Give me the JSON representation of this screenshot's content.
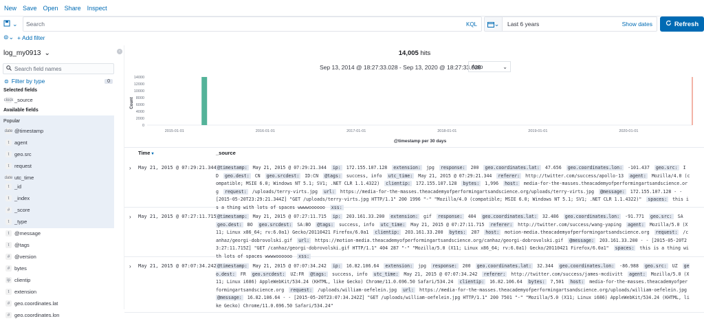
{
  "topnav": [
    "New",
    "Save",
    "Open",
    "Share",
    "Inspect"
  ],
  "query": {
    "placeholder": "Search",
    "language": "KQL"
  },
  "time": {
    "range": "Last 6 years",
    "show_dates": "Show dates",
    "refresh": "Refresh"
  },
  "filters": {
    "add_label": "+ Add filter"
  },
  "sidebar": {
    "index_pattern": "log_my0913",
    "search_placeholder": "Search field names",
    "filter_label": "Filter by type",
    "filter_count": "0",
    "selected_heading": "Selected fields",
    "selected": [
      {
        "type": "clock",
        "name": "_source"
      }
    ],
    "available_heading": "Available fields",
    "popular_heading": "Popular",
    "popular": [
      {
        "type": "date",
        "name": "@timestamp"
      },
      {
        "type": "t",
        "name": "agent"
      },
      {
        "type": "t",
        "name": "geo.src"
      },
      {
        "type": "t",
        "name": "request"
      },
      {
        "type": "date",
        "name": "utc_time"
      }
    ],
    "fields": [
      {
        "type": "t",
        "name": "_id"
      },
      {
        "type": "t",
        "name": "_index"
      },
      {
        "type": "#",
        "name": "_score"
      },
      {
        "type": "t",
        "name": "_type"
      },
      {
        "type": "t",
        "name": "@message"
      },
      {
        "type": "t",
        "name": "@tags"
      },
      {
        "type": "#",
        "name": "@version"
      },
      {
        "type": "#",
        "name": "bytes"
      },
      {
        "type": "ip",
        "name": "clientip"
      },
      {
        "type": "t",
        "name": "extension"
      },
      {
        "type": "#",
        "name": "geo.coordinates.lat"
      },
      {
        "type": "#",
        "name": "geo.coordinates.lon"
      }
    ]
  },
  "main": {
    "hits_count": "14,005",
    "hits_label": "hits",
    "date_range": "Sep 13, 2014 @ 18:27:33.028 - Sep 13, 2020 @ 18:27:33.028",
    "interval": "Auto",
    "col_time": "Time",
    "col_source": "_source"
  },
  "chart_data": {
    "type": "bar",
    "ylabel": "Count",
    "xlabel": "@timestamp per 30 days",
    "yticks": [
      0,
      2000,
      4000,
      6000,
      8000,
      10000,
      12000,
      14000
    ],
    "ylim": [
      0,
      14000
    ],
    "xticks": [
      "2015-01-01",
      "2016-01-01",
      "2017-01-01",
      "2018-01-01",
      "2019-01-01",
      "2020-01-01"
    ],
    "bars": [
      {
        "x": "2015-05-01",
        "value": 14005
      }
    ],
    "now_marker": "2020-09-13",
    "colors": {
      "bar": "#54b399",
      "now": "#e7664c"
    }
  },
  "rows": [
    {
      "time": "May 21, 2015 @ 07:29:21.344",
      "fields": [
        [
          "@timestamp:",
          "May 21, 2015 @ 07:29:21.344"
        ],
        [
          "ip:",
          "172.155.107.128"
        ],
        [
          "extension:",
          "jpg"
        ],
        [
          "response:",
          "200"
        ],
        [
          "geo.coordinates.lat:",
          "47.656"
        ],
        [
          "geo.coordinates.lon:",
          "-101.437"
        ],
        [
          "geo.src:",
          "ID"
        ],
        [
          "geo.dest:",
          "CN"
        ],
        [
          "geo.srcdest:",
          "ID:CN"
        ],
        [
          "@tags:",
          "success, info"
        ],
        [
          "utc_time:",
          "May 21, 2015 @ 07:29:21.344"
        ],
        [
          "referer:",
          "http://twitter.com/success/apollo-13"
        ],
        [
          "agent:",
          "Mozilla/4.0 (compatible; MSIE 6.0; Windows NT 5.1; SV1; .NET CLR 1.1.4322)"
        ],
        [
          "clientip:",
          "172.155.107.128"
        ],
        [
          "bytes:",
          "1,996"
        ],
        [
          "host:",
          "media-for-the-masses.theacademyofperformingartsandscience.org"
        ],
        [
          "request:",
          "/uploads/terry-virts.jpg"
        ],
        [
          "url:",
          "https://media-for-the-masses.theacademyofperformingartsandscience.org/uploads/terry-virts.jpg"
        ],
        [
          "@message:",
          "172.155.107.128 - - [2015-05-20T23:29:21.344Z] \"GET /uploads/terry-virts.jpg HTTP/1.1\" 200 1996 \"-\" \"Mozilla/4.0 (compatible; MSIE 6.0; Windows NT 5.1; SV1; .NET CLR 1.1.4322)\""
        ],
        [
          "spaces:",
          "this is a thing with lots of spaces wwwwoooooo"
        ],
        [
          "xss:",
          ""
        ]
      ]
    },
    {
      "time": "May 21, 2015 @ 07:27:11.715",
      "fields": [
        [
          "@timestamp:",
          "May 21, 2015 @ 07:27:11.715"
        ],
        [
          "ip:",
          "203.161.33.200"
        ],
        [
          "extension:",
          "gif"
        ],
        [
          "response:",
          "404"
        ],
        [
          "geo.coordinates.lat:",
          "32.486"
        ],
        [
          "geo.coordinates.lon:",
          "-91.771"
        ],
        [
          "geo.src:",
          "SA"
        ],
        [
          "geo.dest:",
          "BO"
        ],
        [
          "geo.srcdest:",
          "SA:BO"
        ],
        [
          "@tags:",
          "success, info"
        ],
        [
          "utc_time:",
          "May 21, 2015 @ 07:27:11.715"
        ],
        [
          "referer:",
          "http://twitter.com/success/wang-yaping"
        ],
        [
          "agent:",
          "Mozilla/5.0 (X11; Linux x86_64; rv:6.0a1) Gecko/20110421 Firefox/6.0a1"
        ],
        [
          "clientip:",
          "203.161.33.200"
        ],
        [
          "bytes:",
          "287"
        ],
        [
          "host:",
          "motion-media.theacademyofperformingartsandscience.org"
        ],
        [
          "request:",
          "/canhaz/georgi-dobrovolski.gif"
        ],
        [
          "url:",
          "https://motion-media.theacademyofperformingartsandscience.org/canhaz/georgi-dobrovolski.gif"
        ],
        [
          "@message:",
          "203.161.33.200 - - [2015-05-20T23:27:11.715Z] \"GET /canhaz/georgi-dobrovolski.gif HTTP/1.1\" 404 287 \"-\" \"Mozilla/5.0 (X11; Linux x86_64; rv:6.0a1) Gecko/20110421 Firefox/6.0a1\""
        ],
        [
          "spaces:",
          "this is a thing with lots of spaces wwwwoooooo"
        ],
        [
          "xss:",
          ""
        ]
      ]
    },
    {
      "time": "May 21, 2015 @ 07:07:34.242",
      "fields": [
        [
          "@timestamp:",
          "May 21, 2015 @ 07:07:34.242"
        ],
        [
          "ip:",
          "16.82.106.64"
        ],
        [
          "extension:",
          "jpg"
        ],
        [
          "response:",
          "200"
        ],
        [
          "geo.coordinates.lat:",
          "32.344"
        ],
        [
          "geo.coordinates.lon:",
          "-86.988"
        ],
        [
          "geo.src:",
          "UZ"
        ],
        [
          "geo.dest:",
          "FR"
        ],
        [
          "geo.srcdest:",
          "UZ:FR"
        ],
        [
          "@tags:",
          "success, info"
        ],
        [
          "utc_time:",
          "May 21, 2015 @ 07:07:34.242"
        ],
        [
          "referer:",
          "http://twitter.com/success/james-mcdivitt"
        ],
        [
          "agent:",
          "Mozilla/5.0 (X11; Linux i686) AppleWebKit/534.24 (KHTML, like Gecko) Chrome/11.0.696.50 Safari/534.24"
        ],
        [
          "clientip:",
          "16.82.106.64"
        ],
        [
          "bytes:",
          "7,501"
        ],
        [
          "host:",
          "media-for-the-masses.theacademyofperformingartsandscience.org"
        ],
        [
          "request:",
          "/uploads/william-oefelein.jpg"
        ],
        [
          "url:",
          "https://media-for-the-masses.theacademyofperformingartsandscience.org/uploads/william-oefelein.jpg"
        ],
        [
          "@message:",
          "16.82.106.64 - - [2015-05-20T23:07:34.242Z] \"GET /uploads/william-oefelein.jpg HTTP/1.1\" 200 7501 \"-\" \"Mozilla/5.0 (X11; Linux i686) AppleWebKit/534.24 (KHTML, like Gecko) Chrome/11.0.696.50 Safari/534.24\""
        ]
      ]
    }
  ]
}
